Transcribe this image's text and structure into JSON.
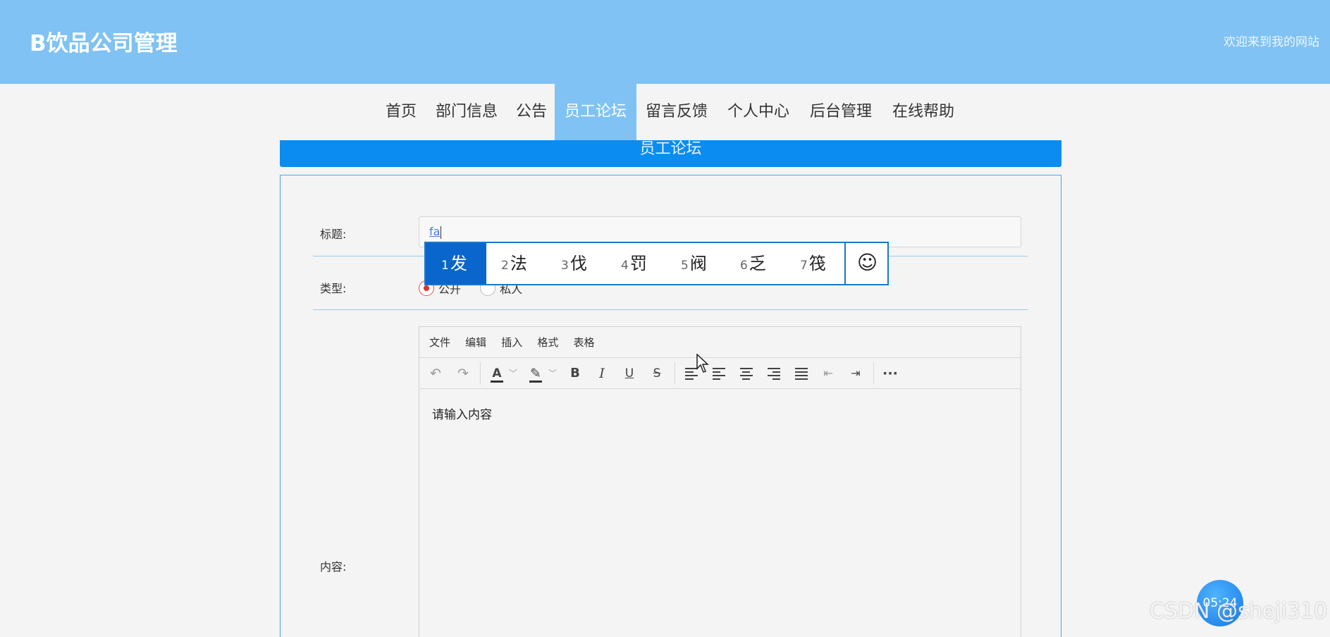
{
  "header": {
    "brand": "B饮品公司管理",
    "welcome": "欢迎来到我的网站"
  },
  "nav": {
    "items": [
      {
        "label": "首页"
      },
      {
        "label": "部门信息"
      },
      {
        "label": "公告"
      },
      {
        "label": "员工论坛",
        "active": true
      },
      {
        "label": "留言反馈"
      },
      {
        "label": "个人中心"
      },
      {
        "label": "后台管理"
      },
      {
        "label": "在线帮助"
      }
    ]
  },
  "section": {
    "title": "员工论坛"
  },
  "form": {
    "title_label": "标题:",
    "title_value": "fa",
    "type_label": "类型:",
    "type_options": [
      {
        "label": "公开",
        "checked": true
      },
      {
        "label": "私人",
        "checked": false
      }
    ],
    "content_label": "内容:"
  },
  "editor": {
    "menu": [
      "文件",
      "编辑",
      "插入",
      "格式",
      "表格"
    ],
    "toolbar_icons": [
      "undo-icon",
      "redo-icon",
      "font-color-icon",
      "highlight-icon",
      "bold-icon",
      "italic-icon",
      "underline-icon",
      "strikethrough-icon",
      "align-left-icon",
      "align-left-icon",
      "align-center-icon",
      "align-right-icon",
      "align-justify-icon",
      "outdent-icon",
      "indent-icon",
      "more-icon"
    ],
    "bold": "B",
    "italic": "I",
    "underline": "U",
    "strike": "S",
    "font_color": "A",
    "more": "···",
    "placeholder": "请输入内容"
  },
  "ime": {
    "candidates": [
      {
        "num": "1",
        "text": "发"
      },
      {
        "num": "2",
        "text": "法"
      },
      {
        "num": "3",
        "text": "伐"
      },
      {
        "num": "4",
        "text": "罚"
      },
      {
        "num": "5",
        "text": "阀"
      },
      {
        "num": "6",
        "text": "乏"
      },
      {
        "num": "7",
        "text": "筏"
      }
    ],
    "emoji": "☺"
  },
  "overlay": {
    "timer": "05:24",
    "watermark": "CSDN @sheji310"
  },
  "colors": {
    "header_bg": "#7fc2f3",
    "section_bar": "#0a8cf0",
    "ime_active": "#0a66cc"
  }
}
